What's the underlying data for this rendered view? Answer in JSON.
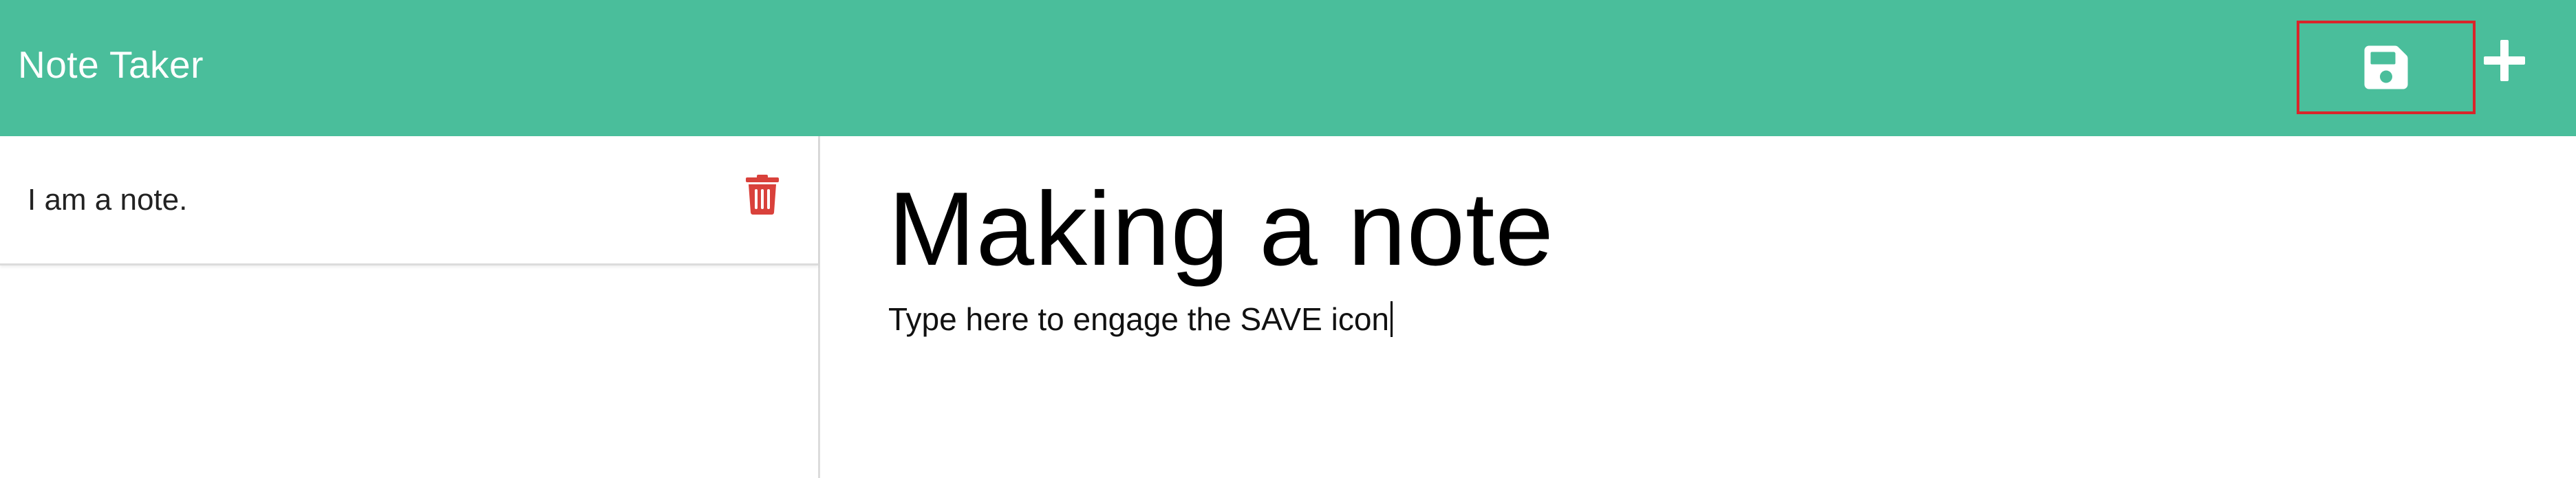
{
  "app": {
    "title": "Note Taker"
  },
  "toolbar": {
    "save_icon": "floppy-disk-icon",
    "add_icon": "plus-icon",
    "icon_color": "#ffffff",
    "highlight_color": "#d9252a",
    "nav_color": "#4abe9b"
  },
  "notes": [
    {
      "title": "I am a note.",
      "delete_icon": "trash-icon",
      "delete_color": "#d9413b"
    }
  ],
  "editor": {
    "title": "Making a note",
    "body": "Type here to engage the SAVE icon"
  }
}
